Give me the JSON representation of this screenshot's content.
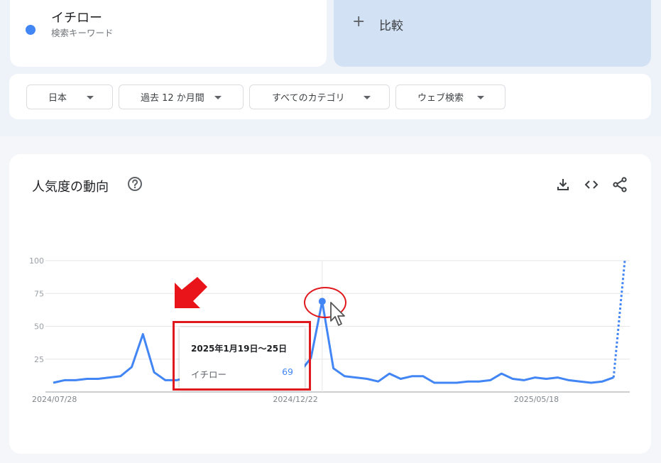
{
  "term": {
    "name": "イチロー",
    "subtitle": "検索キーワード",
    "color": "#4285f4"
  },
  "compare": {
    "plus": "+",
    "label": "比較"
  },
  "filters": [
    {
      "label": "日本"
    },
    {
      "label": "過去 12 か月間"
    },
    {
      "label": "すべてのカテゴリ"
    },
    {
      "label": "ウェブ検索"
    }
  ],
  "chart_section": {
    "title": "人気度の動向",
    "help_icon": "help-circle-icon",
    "actions": [
      "download-icon",
      "embed-code-icon",
      "share-icon"
    ]
  },
  "chart_data": {
    "type": "line",
    "title": "",
    "xlabel": "",
    "ylabel": "",
    "ylim": [
      0,
      100
    ],
    "yticks": [
      25,
      50,
      75,
      100
    ],
    "xtick_labels": [
      "2024/07/28",
      "2024/12/22",
      "2025/05/18"
    ],
    "series": [
      {
        "name": "イチロー",
        "color": "#4285f4",
        "values": [
          7,
          9,
          9,
          10,
          10,
          11,
          12,
          19,
          44,
          15,
          9,
          9,
          11,
          14,
          9,
          18,
          14,
          10,
          10,
          10,
          25,
          15,
          15,
          26,
          69,
          18,
          12,
          11,
          10,
          8,
          14,
          10,
          12,
          12,
          7,
          7,
          7,
          8,
          8,
          9,
          14,
          10,
          9,
          11,
          10,
          11,
          9,
          8,
          7,
          8,
          11,
          100
        ],
        "partial_last": true
      }
    ],
    "grid": true
  },
  "tooltip": {
    "date": "2025年1月19日〜25日",
    "term": "イチロー",
    "value": "69"
  }
}
